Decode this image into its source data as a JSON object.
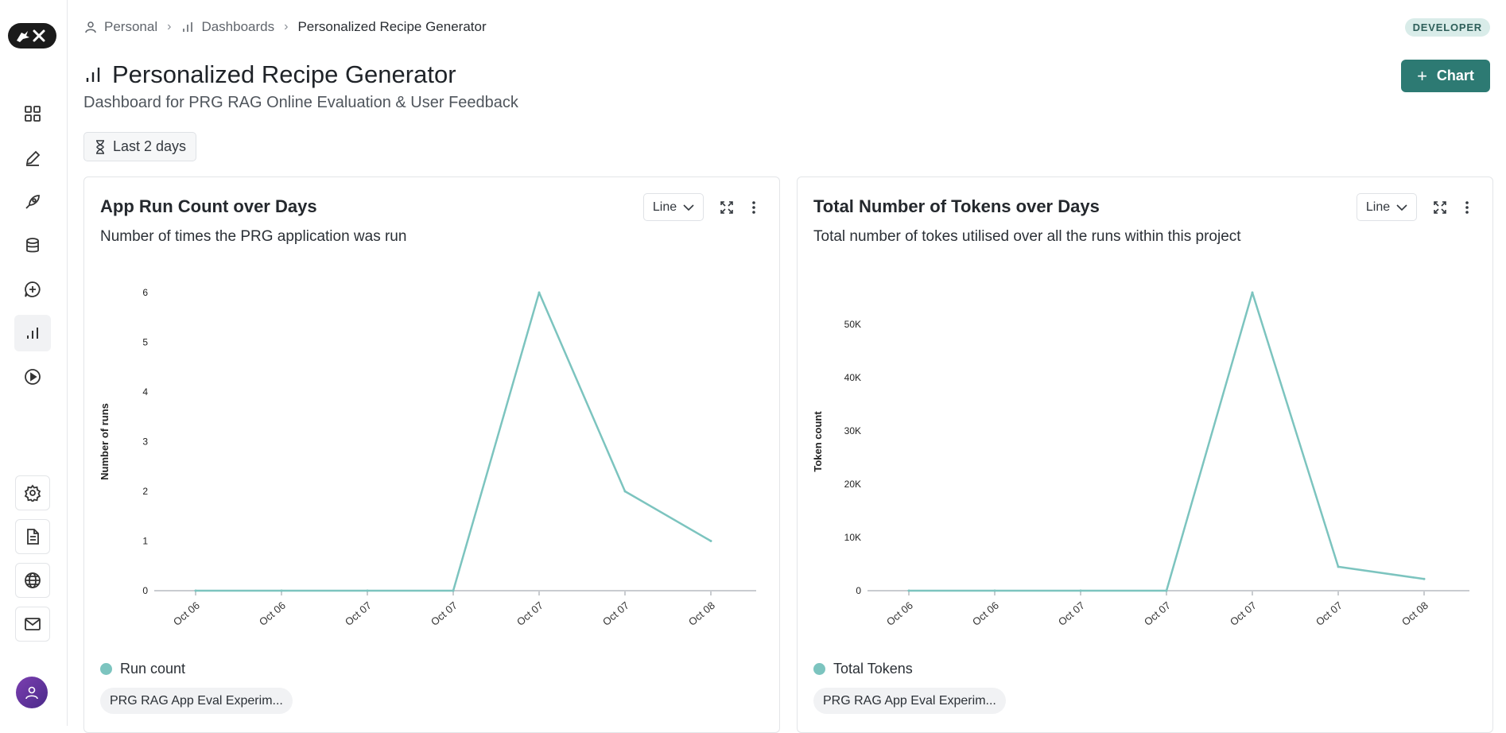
{
  "breadcrumb": {
    "items": [
      {
        "label": "Personal",
        "icon": "user-icon"
      },
      {
        "label": "Dashboards",
        "icon": "bar-chart-icon"
      },
      {
        "label": "Personalized Recipe Generator"
      }
    ]
  },
  "badge": "DEVELOPER",
  "page": {
    "title": "Personalized Recipe Generator",
    "subtitle": "Dashboard for PRG RAG Online Evaluation & User Feedback",
    "add_chart_label": "Chart",
    "time_range": "Last 2 days"
  },
  "sidebar": {
    "nav": [
      "grid-icon",
      "pencil-icon",
      "rocket-icon",
      "database-icon",
      "chat-plus-icon",
      "bar-chart-icon",
      "play-icon"
    ],
    "active": "bar-chart-icon",
    "bottom": [
      "gear-icon",
      "document-icon",
      "globe-icon",
      "mail-icon"
    ]
  },
  "colors": {
    "accent": "#2d7a73",
    "series": "#7cc4bf"
  },
  "cards": [
    {
      "title": "App Run Count over Days",
      "description": "Number of times the PRG application was run",
      "chart_type_label": "Line",
      "legend": "Run count",
      "experiment_chip": "PRG RAG App Eval Experim..."
    },
    {
      "title": "Total Number of Tokens over Days",
      "description": "Total number of tokes utilised over all the runs within this project",
      "chart_type_label": "Line",
      "legend": "Total Tokens",
      "experiment_chip": "PRG RAG App Eval Experim..."
    }
  ],
  "chart_data": [
    {
      "type": "line",
      "title": "App Run Count over Days",
      "subtitle": "Number of times the PRG application was run",
      "categories": [
        "Oct 06",
        "Oct 06",
        "Oct 07",
        "Oct 07",
        "Oct 07",
        "Oct 07",
        "Oct 08"
      ],
      "series": [
        {
          "name": "Run count",
          "values": [
            0,
            0,
            0,
            0,
            6,
            2,
            1
          ]
        }
      ],
      "ylabel": "Number of runs",
      "xlabel": "",
      "ylim": [
        0,
        6
      ],
      "yticks": [
        0,
        1,
        2,
        3,
        4,
        5,
        6
      ],
      "ytick_labels": [
        "0",
        "1",
        "2",
        "3",
        "4",
        "5",
        "6"
      ],
      "legend": "bottom-left",
      "grid": false
    },
    {
      "type": "line",
      "title": "Total Number of Tokens over Days",
      "subtitle": "Total number of tokes utilised over all the runs within this project",
      "categories": [
        "Oct 06",
        "Oct 06",
        "Oct 07",
        "Oct 07",
        "Oct 07",
        "Oct 07",
        "Oct 08"
      ],
      "series": [
        {
          "name": "Total Tokens",
          "values": [
            0,
            0,
            0,
            0,
            56000,
            4500,
            2200
          ]
        }
      ],
      "ylabel": "Token count",
      "xlabel": "",
      "ylim": [
        0,
        56000
      ],
      "yticks": [
        0,
        10000,
        20000,
        30000,
        40000,
        50000
      ],
      "ytick_labels": [
        "0",
        "10K",
        "20K",
        "30K",
        "40K",
        "50K"
      ],
      "legend": "bottom-left",
      "grid": false
    }
  ]
}
